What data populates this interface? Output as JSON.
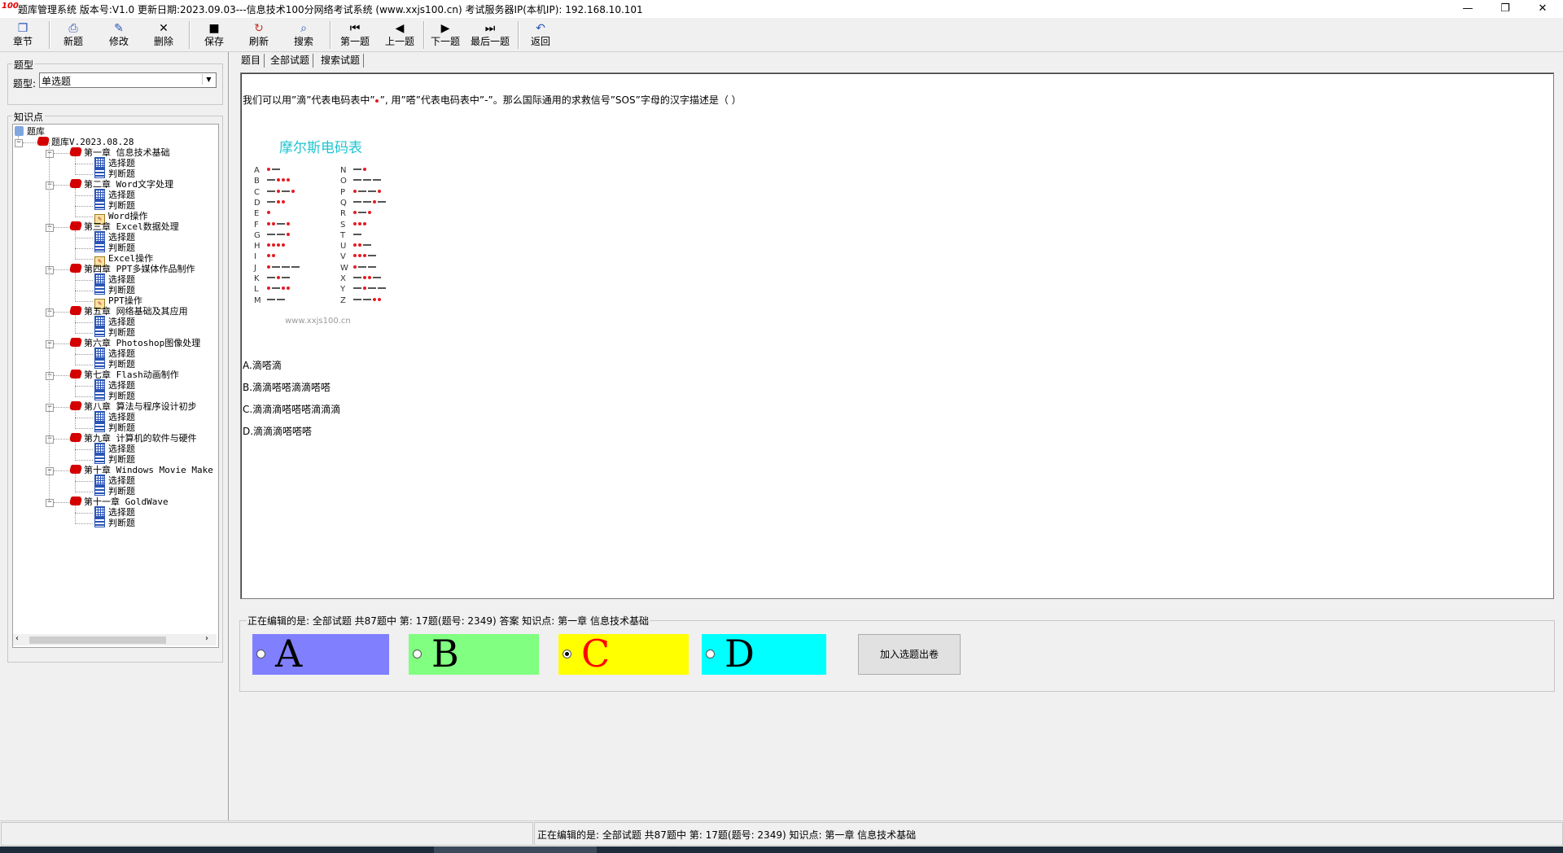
{
  "window": {
    "title": "题库管理系统 版本号:V1.0 更新日期:2023.09.03---信息技术100分网络考试系统    (www.xxjs100.cn)    考试服务器IP(本机IP):  192.168.10.101",
    "logo": "100"
  },
  "toolbar": {
    "chapter": "章节",
    "new": "新题",
    "edit": "修改",
    "delete": "删除",
    "save": "保存",
    "refresh": "刷新",
    "search": "搜索",
    "first": "第一题",
    "prev": "上一题",
    "next": "下一题",
    "last": "最后一题",
    "back": "返回"
  },
  "type_group": {
    "title": "题型",
    "label": "题型:",
    "selected": "单选题"
  },
  "knowledge_group": {
    "title": "知识点"
  },
  "tree": {
    "root": "题库",
    "bank": "题库V.2023.08.28",
    "chapters": [
      {
        "label": "第一章 信息技术基础",
        "children": [
          "选择题",
          "判断题"
        ]
      },
      {
        "label": "第二章 Word文字处理",
        "children": [
          "选择题",
          "判断题",
          "Word操作"
        ]
      },
      {
        "label": "第三章 Excel数据处理",
        "children": [
          "选择题",
          "判断题",
          "Excel操作"
        ]
      },
      {
        "label": "第四章 PPT多媒体作品制作",
        "children": [
          "选择题",
          "判断题",
          "PPT操作"
        ]
      },
      {
        "label": "第五章 网络基础及其应用",
        "children": [
          "选择题",
          "判断题"
        ]
      },
      {
        "label": "第六章 Photoshop图像处理",
        "children": [
          "选择题",
          "判断题"
        ]
      },
      {
        "label": "第七章 Flash动画制作",
        "children": [
          "选择题",
          "判断题"
        ]
      },
      {
        "label": "第八章 算法与程序设计初步",
        "children": [
          "选择题",
          "判断题"
        ]
      },
      {
        "label": "第九章 计算机的软件与硬件",
        "children": [
          "选择题",
          "判断题"
        ]
      },
      {
        "label": "第十章 Windows Movie Make",
        "children": [
          "选择题",
          "判断题"
        ]
      },
      {
        "label": "第十一章 GoldWave",
        "children": [
          "选择题",
          "判断题"
        ]
      }
    ]
  },
  "tabs": [
    "题目",
    "全部试题",
    "搜索试题"
  ],
  "question": {
    "text_before": "我们可以用”滴”代表电码表中”",
    "text_after": "”, 用”嗒”代表电码表中”-”。那么国际通用的求救信号”SOS”字母的汉字描述是（ ）",
    "image_title": "摩尔斯电码表",
    "image_watermark": "www.xxjs100.cn",
    "morse_left": [
      {
        "letter": "A",
        "code": ".-"
      },
      {
        "letter": "B",
        "code": "-..."
      },
      {
        "letter": "C",
        "code": "-.-."
      },
      {
        "letter": "D",
        "code": "-.."
      },
      {
        "letter": "E",
        "code": "."
      },
      {
        "letter": "F",
        "code": "..-."
      },
      {
        "letter": "G",
        "code": "--."
      },
      {
        "letter": "H",
        "code": "...."
      },
      {
        "letter": "I",
        "code": ".."
      },
      {
        "letter": "J",
        "code": ".---"
      },
      {
        "letter": "K",
        "code": "-.-"
      },
      {
        "letter": "L",
        "code": ".-.."
      },
      {
        "letter": "M",
        "code": "--"
      }
    ],
    "morse_right": [
      {
        "letter": "N",
        "code": "-."
      },
      {
        "letter": "O",
        "code": "---"
      },
      {
        "letter": "P",
        "code": ".--."
      },
      {
        "letter": "Q",
        "code": "--.-"
      },
      {
        "letter": "R",
        "code": ".-."
      },
      {
        "letter": "S",
        "code": "..."
      },
      {
        "letter": "T",
        "code": "-"
      },
      {
        "letter": "U",
        "code": "..-"
      },
      {
        "letter": "V",
        "code": "...-"
      },
      {
        "letter": "W",
        "code": ".--"
      },
      {
        "letter": "X",
        "code": "-..-"
      },
      {
        "letter": "Y",
        "code": "-.--"
      },
      {
        "letter": "Z",
        "code": "--.."
      }
    ],
    "options": [
      "A.滴嗒滴",
      "B.滴滴嗒嗒滴滴嗒嗒",
      "C.滴滴滴嗒嗒嗒滴滴滴",
      "D.滴滴滴嗒嗒嗒"
    ]
  },
  "editing": {
    "title": "正在编辑的是: 全部试题 共87题中  第: 17题(题号: 2349) 答案 知识点: 第一章 信息技术基础",
    "answers": [
      {
        "letter": "A",
        "bg": "#8080ff",
        "fg": "#000000",
        "checked": false
      },
      {
        "letter": "B",
        "bg": "#80ff80",
        "fg": "#000000",
        "checked": false
      },
      {
        "letter": "C",
        "bg": "#ffff00",
        "fg": "#ff0000",
        "checked": true
      },
      {
        "letter": "D",
        "bg": "#00ffff",
        "fg": "#000000",
        "checked": false
      }
    ],
    "add_button": "加入选题出卷"
  },
  "status": {
    "text": "正在编辑的是: 全部试题 共87题中  第: 17题(题号: 2349)  知识点: 第一章 信息技术基础"
  }
}
